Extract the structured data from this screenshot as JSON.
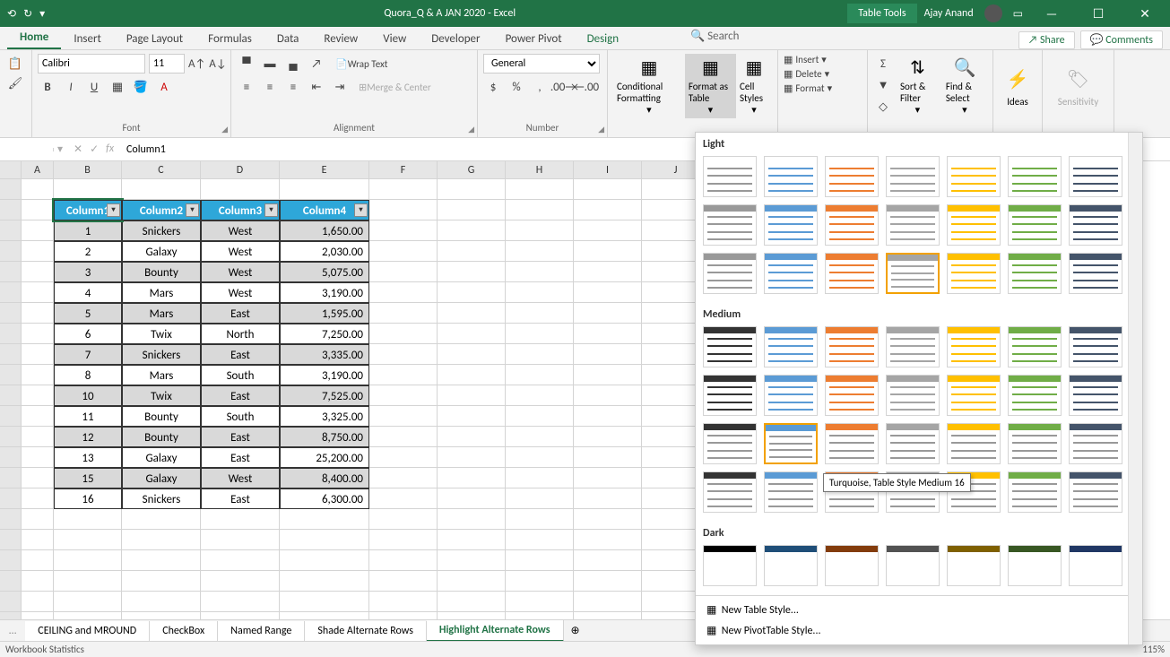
{
  "titlebar": {
    "title": "Quora_Q & A JAN 2020  -  Excel",
    "tabletools": "Table Tools",
    "username": "Ajay Anand"
  },
  "tabs": [
    "Home",
    "Insert",
    "Page Layout",
    "Formulas",
    "Data",
    "Review",
    "View",
    "Developer",
    "Power Pivot",
    "Design"
  ],
  "search_placeholder": "Search",
  "share": "Share",
  "comments": "Comments",
  "ribbon": {
    "font_name": "Calibri",
    "font_size": "11",
    "wrap": "Wrap Text",
    "merge": "Merge & Center",
    "numfmt": "General",
    "cond": "Conditional Formatting",
    "fat": "Format as Table",
    "cellstyles": "Cell Styles",
    "insert": "Insert",
    "delete": "Delete",
    "format": "Format",
    "sort": "Sort & Filter",
    "find": "Find & Select",
    "ideas": "Ideas",
    "sens": "Sensitivity",
    "groups": {
      "font": "Font",
      "align": "Alignment",
      "number": "Number"
    }
  },
  "namebox": "",
  "formula": "Column1",
  "cols": [
    "A",
    "B",
    "C",
    "D",
    "E",
    "F",
    "G",
    "H",
    "I",
    "J"
  ],
  "table": {
    "headers": [
      "Column1",
      "Column2",
      "Column3",
      "Column4"
    ],
    "rows": [
      [
        "1",
        "Snickers",
        "West",
        "1,650.00"
      ],
      [
        "2",
        "Galaxy",
        "West",
        "2,030.00"
      ],
      [
        "3",
        "Bounty",
        "West",
        "5,075.00"
      ],
      [
        "4",
        "Mars",
        "West",
        "3,190.00"
      ],
      [
        "5",
        "Mars",
        "East",
        "1,595.00"
      ],
      [
        "6",
        "Twix",
        "North",
        "7,250.00"
      ],
      [
        "7",
        "Snickers",
        "East",
        "3,335.00"
      ],
      [
        "8",
        "Mars",
        "South",
        "3,190.00"
      ],
      [
        "10",
        "Twix",
        "East",
        "7,525.00"
      ],
      [
        "11",
        "Bounty",
        "South",
        "3,325.00"
      ],
      [
        "12",
        "Bounty",
        "East",
        "8,750.00"
      ],
      [
        "13",
        "Galaxy",
        "East",
        "25,200.00"
      ],
      [
        "15",
        "Galaxy",
        "West",
        "8,400.00"
      ],
      [
        "16",
        "Snickers",
        "East",
        "6,300.00"
      ]
    ]
  },
  "stylepanel": {
    "sections": [
      "Light",
      "Medium",
      "Dark"
    ],
    "tooltip": "Turquoise, Table Style Medium 16",
    "new_table_style": "New Table Style...",
    "new_pivot_style": "New PivotTable Style..."
  },
  "sheets": [
    "CEILING and MROUND",
    "CheckBox",
    "Named Range",
    "Shade Alternate Rows",
    "Highlight Alternate Rows"
  ],
  "status": {
    "left": "Workbook Statistics",
    "zoom": "115%"
  },
  "style_colors": {
    "light": [
      "#999",
      "#5b9bd5",
      "#ed7d31",
      "#a5a5a5",
      "#ffc000",
      "#70ad47",
      "#44546a"
    ],
    "medium": [
      "#333",
      "#5b9bd5",
      "#2f75b5",
      "#9e480e",
      "#7f7f7f",
      "#70ad47",
      "#375623"
    ],
    "dark": [
      "#000",
      "#1f4e78",
      "#833c0c",
      "#525252",
      "#7f6000",
      "#385723",
      "#203764"
    ]
  }
}
